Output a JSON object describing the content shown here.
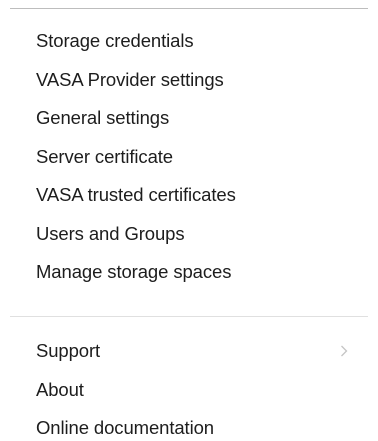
{
  "menu": {
    "group1": [
      {
        "label": "Storage credentials"
      },
      {
        "label": "VASA Provider settings"
      },
      {
        "label": "General settings"
      },
      {
        "label": "Server certificate"
      },
      {
        "label": "VASA trusted certificates"
      },
      {
        "label": "Users and Groups"
      },
      {
        "label": "Manage storage spaces"
      }
    ],
    "group2": [
      {
        "label": "Support",
        "icon": "chevron-right-icon"
      },
      {
        "label": "About"
      },
      {
        "label": "Online documentation"
      }
    ]
  },
  "colors": {
    "text": "#1d1d1d",
    "separator": "#e0e0e0",
    "chevron": "#c4c4c4"
  }
}
